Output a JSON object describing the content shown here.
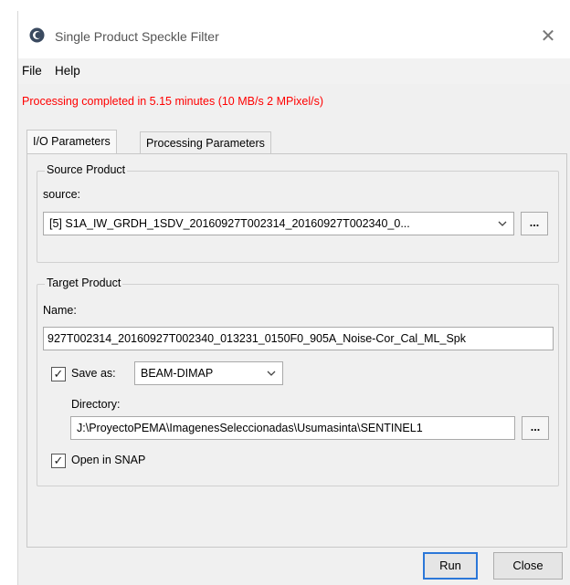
{
  "window": {
    "title": "Single Product Speckle Filter",
    "close_symbol": "✕",
    "icon": "snap-app-icon"
  },
  "menu": {
    "items": [
      "File",
      "Help"
    ]
  },
  "status": {
    "message": "Processing completed in 5.15 minutes (10 MB/s 2 MPixel/s)",
    "color": "#ff0000"
  },
  "tabs": {
    "items": [
      "I/O Parameters",
      "Processing Parameters"
    ],
    "active": "I/O Parameters"
  },
  "source_product": {
    "title": "Source Product",
    "source_label": "source:",
    "selected": "[5] S1A_IW_GRDH_1SDV_20160927T002314_20160927T002340_0...",
    "browse_label": "..."
  },
  "target_product": {
    "title": "Target Product",
    "name_label": "Name:",
    "name_value": "927T002314_20160927T002340_013231_0150F0_905A_Noise-Cor_Cal_ML_Spk",
    "save_as_label": "Save as:",
    "save_as_checked": true,
    "format_selected": "BEAM-DIMAP",
    "directory_label": "Directory:",
    "directory_value": "J:\\ProyectoPEMA\\ImagenesSeleccionadas\\Usumasinta\\SENTINEL1",
    "browse_label": "...",
    "open_in_snap_label": "Open in SNAP",
    "open_in_snap_checked": true
  },
  "buttons": {
    "run": "Run",
    "close": "Close"
  }
}
